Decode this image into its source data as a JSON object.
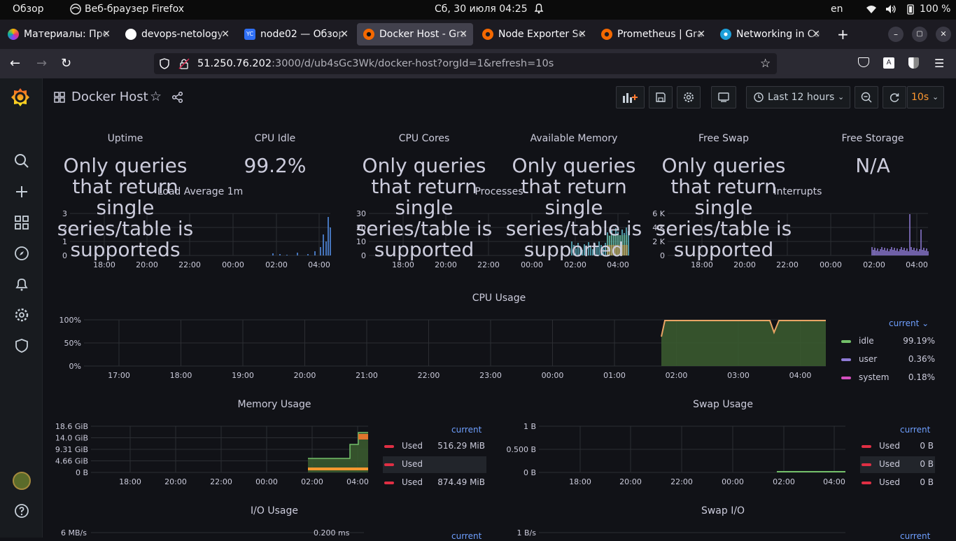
{
  "os_bar": {
    "overview": "Обзор",
    "app": "Веб-браузер Firefox",
    "datetime": "Сб, 30 июля  04:25",
    "lang": "en",
    "battery": "100 %"
  },
  "browser": {
    "tabs": [
      {
        "label": "Материалы: Пре",
        "color": "#8a3ffc"
      },
      {
        "label": "devops-netology",
        "color": "#ffffff"
      },
      {
        "label": "node02 — Обзор",
        "color": "#2f6ff5"
      },
      {
        "label": "Docker Host - Gra",
        "color": "#f46800"
      },
      {
        "label": "Node Exporter Se",
        "color": "#f46800"
      },
      {
        "label": "Prometheus | Gra",
        "color": "#f46800"
      },
      {
        "label": "Networking in Co",
        "color": "#1d9fd9"
      }
    ],
    "url_host": "51.250.76.202",
    "url_rest": ":3000/d/ub4sGc3Wk/docker-host?orgId=1&refresh=10s"
  },
  "grafana": {
    "dashboard_title": "Docker Host",
    "time_range": "Last 12 hours",
    "refresh": "10s",
    "stats": [
      {
        "title": "Uptime",
        "value": "Only queries that return single series/table is supporteds"
      },
      {
        "title": "CPU Idle",
        "value": "99.2%"
      },
      {
        "title": "CPU Cores",
        "value": "Only queries that return single series/table is supported"
      },
      {
        "title": "Available Memory",
        "value": "Only queries that return single series/table is supported"
      },
      {
        "title": "Free Swap",
        "value": "Only queries that return single series/table is supported"
      },
      {
        "title": "Free Storage",
        "value": "N/A"
      }
    ],
    "mini_charts": [
      {
        "title": "Load Average 1m",
        "yticks": [
          "3",
          "2",
          "1",
          "0"
        ],
        "xticks": [
          "18:00",
          "20:00",
          "22:00",
          "00:00",
          "02:00",
          "04:00"
        ]
      },
      {
        "title": "Processes",
        "yticks": [
          "30",
          "20",
          "10",
          "0"
        ],
        "xticks": [
          "18:00",
          "20:00",
          "22:00",
          "00:00",
          "02:00",
          "04:00"
        ]
      },
      {
        "title": "Interrupts",
        "yticks": [
          "6 K",
          "4 K",
          "2 K",
          "0"
        ],
        "xticks": [
          "18:00",
          "20:00",
          "22:00",
          "00:00",
          "02:00",
          "04:00"
        ]
      }
    ],
    "cpu_usage": {
      "title": "CPU Usage",
      "yticks": [
        "100%",
        "50%",
        "0%"
      ],
      "xticks": [
        "17:00",
        "18:00",
        "19:00",
        "20:00",
        "21:00",
        "22:00",
        "23:00",
        "00:00",
        "01:00",
        "02:00",
        "03:00",
        "04:00"
      ],
      "legend_header": "current",
      "legend": [
        {
          "name": "idle",
          "value": "99.19%",
          "color": "#73bf69"
        },
        {
          "name": "user",
          "value": "0.36%",
          "color": "#8f7bd6"
        },
        {
          "name": "system",
          "value": "0.18%",
          "color": "#d44fbf"
        }
      ]
    },
    "memory_usage": {
      "title": "Memory Usage",
      "yticks": [
        "18.6 GiB",
        "14.0 GiB",
        "9.31 GiB",
        "4.66 GiB",
        "0 B"
      ],
      "xticks": [
        "18:00",
        "20:00",
        "22:00",
        "00:00",
        "02:00",
        "04:00"
      ],
      "legend_header": "current",
      "legend": [
        {
          "name": "Used",
          "value": "516.29 MiB",
          "color": "#e02f44"
        },
        {
          "name": "Used",
          "value": "",
          "color": "#e02f44"
        },
        {
          "name": "Used",
          "value": "874.49 MiB",
          "color": "#e02f44"
        }
      ]
    },
    "swap_usage": {
      "title": "Swap Usage",
      "yticks": [
        "1 B",
        "0.500 B",
        "0 B"
      ],
      "xticks": [
        "18:00",
        "20:00",
        "22:00",
        "00:00",
        "02:00",
        "04:00"
      ],
      "legend_header": "current",
      "legend": [
        {
          "name": "Used",
          "value": "0 B",
          "color": "#e02f44"
        },
        {
          "name": "Used",
          "value": "0 B",
          "color": "#e02f44"
        },
        {
          "name": "Used",
          "value": "0 B",
          "color": "#e02f44"
        }
      ]
    },
    "io_usage": {
      "title": "I/O Usage",
      "ytick_left": "6 MB/s",
      "ytick_right": "0.200 ms",
      "legend_header": "current"
    },
    "swap_io": {
      "title": "Swap I/O",
      "ytick": "1 B/s",
      "legend_header": "current"
    }
  }
}
